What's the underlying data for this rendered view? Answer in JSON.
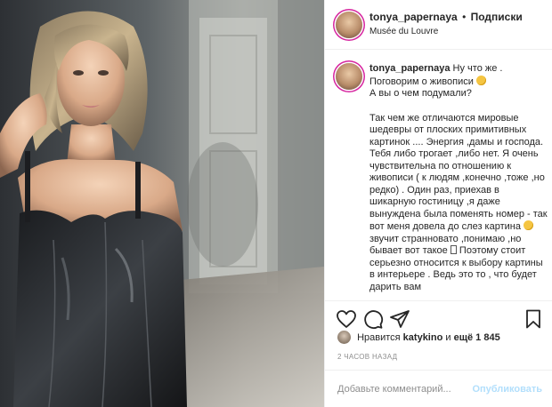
{
  "header": {
    "username": "tonya_papernaya",
    "separator": "•",
    "follow_label": "Подписки",
    "location": "Musée du Louvre"
  },
  "caption": {
    "username": "tonya_papernaya",
    "line1": "Ну что же .",
    "line2": "Поговорим о живописи",
    "line3": "А вы о чем подумали?",
    "body_part1": "Так чем же отличаются мировые шедевры от плоских примитивных картинок .... Энергия ,дамы и господа. Тебя либо трогает ,либо нет. Я очень чувствительна по отношению к живописи ( к людям ,конечно ,тоже ,но редко) . Один раз, приехав в шикарную гостиницу ,я даже вынуждена была поменять номер - так вот меня довела до слез картина",
    "body_part2": "звучит странновато ,понимаю ,но бывает вот такое",
    "body_part3": "Поэтому стоит серьезно относится к выбору картины в интерьере . Ведь это то , что будет дарить вам"
  },
  "icons": {
    "like": "heart-icon",
    "comment": "comment-icon",
    "share": "paper-plane-icon",
    "save": "bookmark-icon"
  },
  "likes": {
    "prefix": "Нравится",
    "user": "katykino",
    "and": "и",
    "others": "ещё 1 845"
  },
  "timestamp": "2 часов назад",
  "comment_box": {
    "placeholder": "Добавьте комментарий...",
    "publish_label": "Опубликовать"
  },
  "colors": {
    "publish_disabled": "#b2dffc",
    "border": "#efefef",
    "muted_text": "#8e8e8e"
  }
}
